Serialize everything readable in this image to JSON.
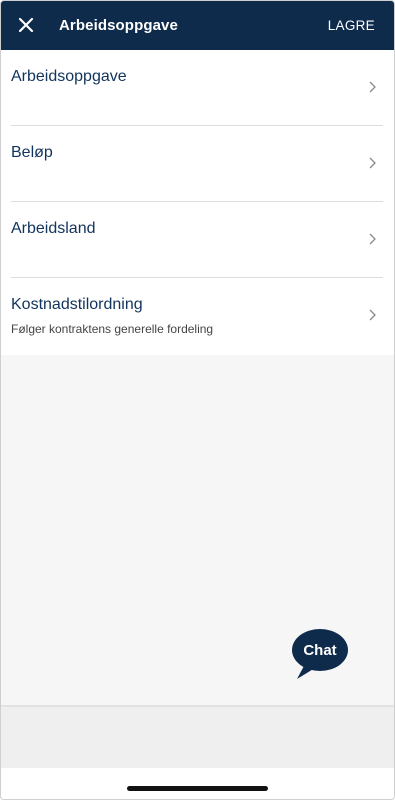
{
  "header": {
    "title": "Arbeidsoppgave",
    "save_label": "LAGRE",
    "close_icon": "close-icon"
  },
  "rows": [
    {
      "label": "Arbeidsoppgave",
      "icon": "chevron-right-icon"
    },
    {
      "label": "Beløp",
      "icon": "chevron-right-icon"
    },
    {
      "label": "Arbeidsland",
      "icon": "chevron-right-icon"
    },
    {
      "label": "Kostnadstilordning",
      "subtitle": "Følger kontraktens generelle fordeling",
      "icon": "chevron-right-icon"
    }
  ],
  "chat": {
    "label": "Chat",
    "icon": "chat-bubble-icon"
  },
  "colors": {
    "header_bg": "#0f2b4c",
    "label_text": "#11335c",
    "chat_bubble": "#0f2b4c"
  }
}
